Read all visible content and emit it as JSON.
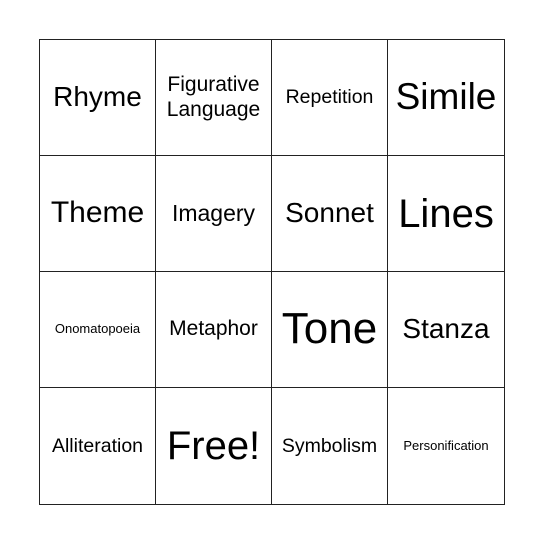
{
  "card": {
    "cells": [
      {
        "text": "Rhyme"
      },
      {
        "text": "Figurative Language"
      },
      {
        "text": "Repetition"
      },
      {
        "text": "Simile"
      },
      {
        "text": "Theme"
      },
      {
        "text": "Imagery"
      },
      {
        "text": "Sonnet"
      },
      {
        "text": "Lines"
      },
      {
        "text": "Onomatopoeia"
      },
      {
        "text": "Metaphor"
      },
      {
        "text": "Tone"
      },
      {
        "text": "Stanza"
      },
      {
        "text": "Alliteration"
      },
      {
        "text": "Free!"
      },
      {
        "text": "Symbolism"
      },
      {
        "text": "Personification"
      }
    ]
  }
}
